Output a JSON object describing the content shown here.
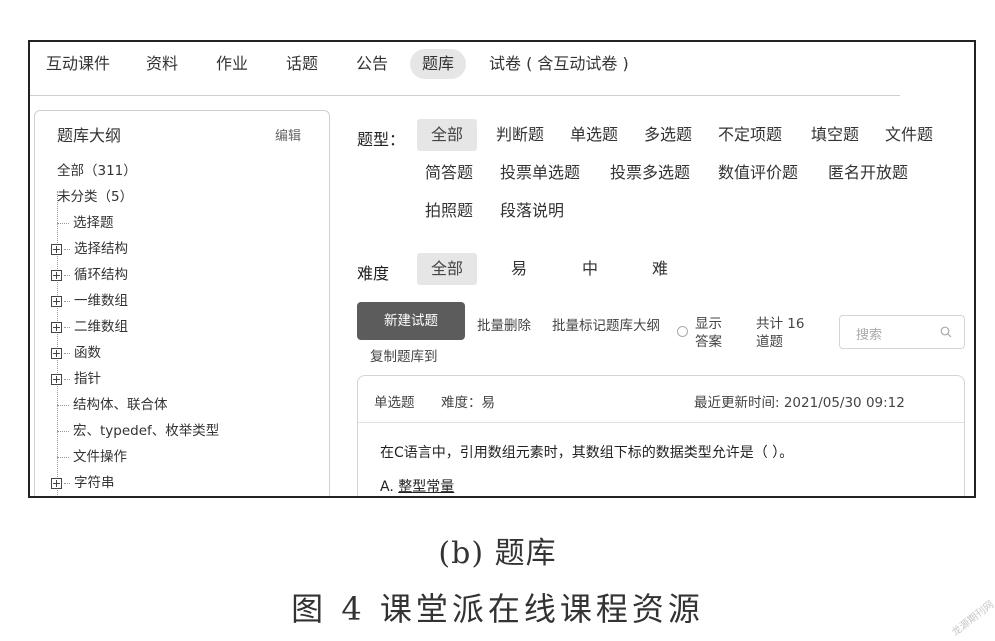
{
  "nav": {
    "items": [
      {
        "label": "互动课件"
      },
      {
        "label": "资料"
      },
      {
        "label": "作业"
      },
      {
        "label": "话题"
      },
      {
        "label": "公告"
      },
      {
        "label": "题库",
        "active": true
      },
      {
        "label": "试卷 ( 含互动试卷 )"
      }
    ]
  },
  "sidebar": {
    "title": "题库大纲",
    "edit_label": "编辑",
    "items": [
      {
        "label": "全部（311）"
      },
      {
        "label": "未分类（5）"
      },
      {
        "label": "选择题"
      },
      {
        "label": "选择结构"
      },
      {
        "label": "循环结构"
      },
      {
        "label": "一维数组"
      },
      {
        "label": "二维数组"
      },
      {
        "label": "函数"
      },
      {
        "label": "指针"
      },
      {
        "label": "结构体、联合体"
      },
      {
        "label": "宏、typedef、枚举类型"
      },
      {
        "label": "文件操作"
      },
      {
        "label": "字符串"
      }
    ]
  },
  "filters": {
    "type_label": "题型：",
    "types": [
      "全部",
      "判断题",
      "单选题",
      "多选题",
      "不定项题",
      "填空题",
      "文件题",
      "简答题",
      "投票单选题",
      "投票多选题",
      "数值评价题",
      "匿名开放题",
      "拍照题",
      "段落说明"
    ],
    "difficulty_label": "难度",
    "difficulties": [
      "全部",
      "易",
      "中",
      "难"
    ]
  },
  "toolbar": {
    "new_button": "新建试题",
    "batch_delete": "批量删除",
    "batch_mark": "批量标记题库大纲",
    "copy_bank": "复制题库到",
    "show_answer_line1": "显示",
    "show_answer_line2": "答案",
    "total_line1": "共计 16",
    "total_line2": "道题",
    "search_placeholder": "搜索"
  },
  "question": {
    "type": "单选题",
    "difficulty": "难度：易",
    "updated": "最近更新时间: 2021/05/30 09:12",
    "text": "在C语言中，引用数组元素时，其数组下标的数据类型允许是（ ）。",
    "option_a_key": "A.",
    "option_a_text": "整型常量"
  },
  "captions": {
    "sub": "(b) 题库",
    "main": "图 4   课堂派在线课程资源"
  },
  "watermark": "龙源期刊网"
}
